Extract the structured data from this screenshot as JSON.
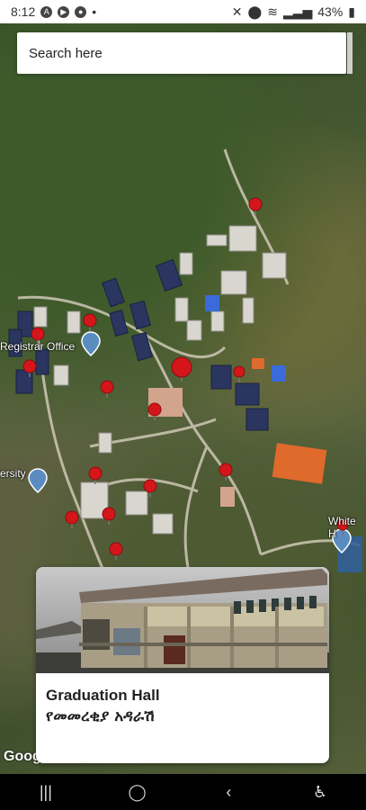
{
  "status_bar": {
    "time": "8:12",
    "battery": "43%"
  },
  "search": {
    "placeholder": "Search here"
  },
  "map": {
    "labels": {
      "registrar": "Registrar Office",
      "university": "ersity",
      "white_house": "White H"
    },
    "pin_color": "#d4161b",
    "attribution": "Goog"
  },
  "card": {
    "title": "Graduation Hall",
    "subtitle": "የመመረቂያ አዳራሽ"
  },
  "nav": {
    "recents": "|||",
    "home": "◯",
    "back": "‹",
    "accessibility": "♿"
  }
}
